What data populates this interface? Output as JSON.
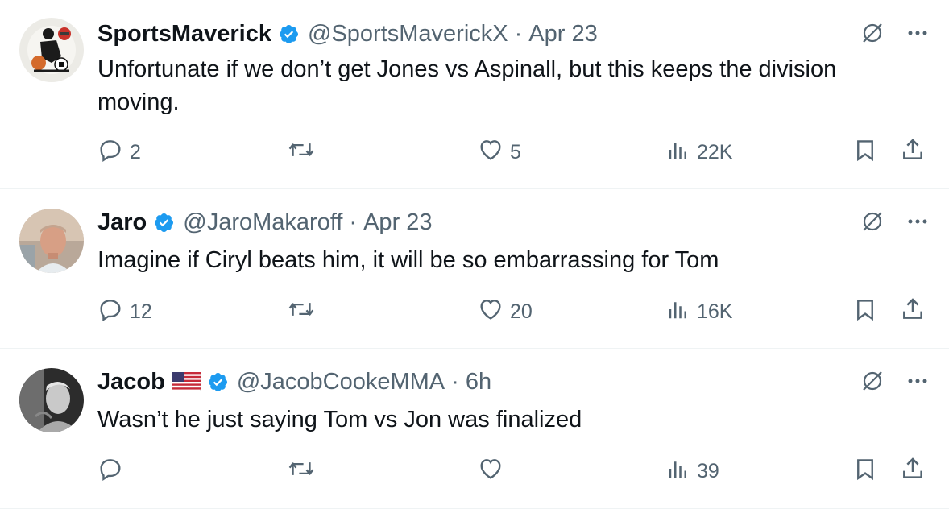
{
  "tweets": [
    {
      "name": "SportsMaverick",
      "verified": true,
      "flag": false,
      "handle": "@SportsMaverickX",
      "dot": "·",
      "time": "Apr 23",
      "text": "Unfortunate if we don’t get Jones vs Aspinall, but this keeps the division\nmoving.",
      "replies": "2",
      "retweets": "",
      "likes": "5",
      "views": "22K",
      "avatar_icon": "sports-collage-avatar"
    },
    {
      "name": "Jaro",
      "verified": true,
      "flag": false,
      "handle": "@JaroMakaroff",
      "dot": "·",
      "time": "Apr 23",
      "text": "Imagine if Ciryl beats him, it will be so embarrassing for Tom",
      "replies": "12",
      "retweets": "",
      "likes": "20",
      "views": "16K",
      "avatar_icon": "user-photo-avatar"
    },
    {
      "name": "Jacob",
      "verified": true,
      "flag": true,
      "flag_icon": "us-flag-icon",
      "handle": "@JacobCookeMMA",
      "dot": "·",
      "time": "6h",
      "text": "Wasn’t he just saying Tom vs Jon was finalized",
      "replies": "",
      "retweets": "",
      "likes": "",
      "views": "39",
      "avatar_icon": "user-photo-avatar"
    }
  ],
  "colors": {
    "text": "#0f1419",
    "secondary": "#536471",
    "verified": "#1d9bf0",
    "divider": "#eff3f4"
  }
}
